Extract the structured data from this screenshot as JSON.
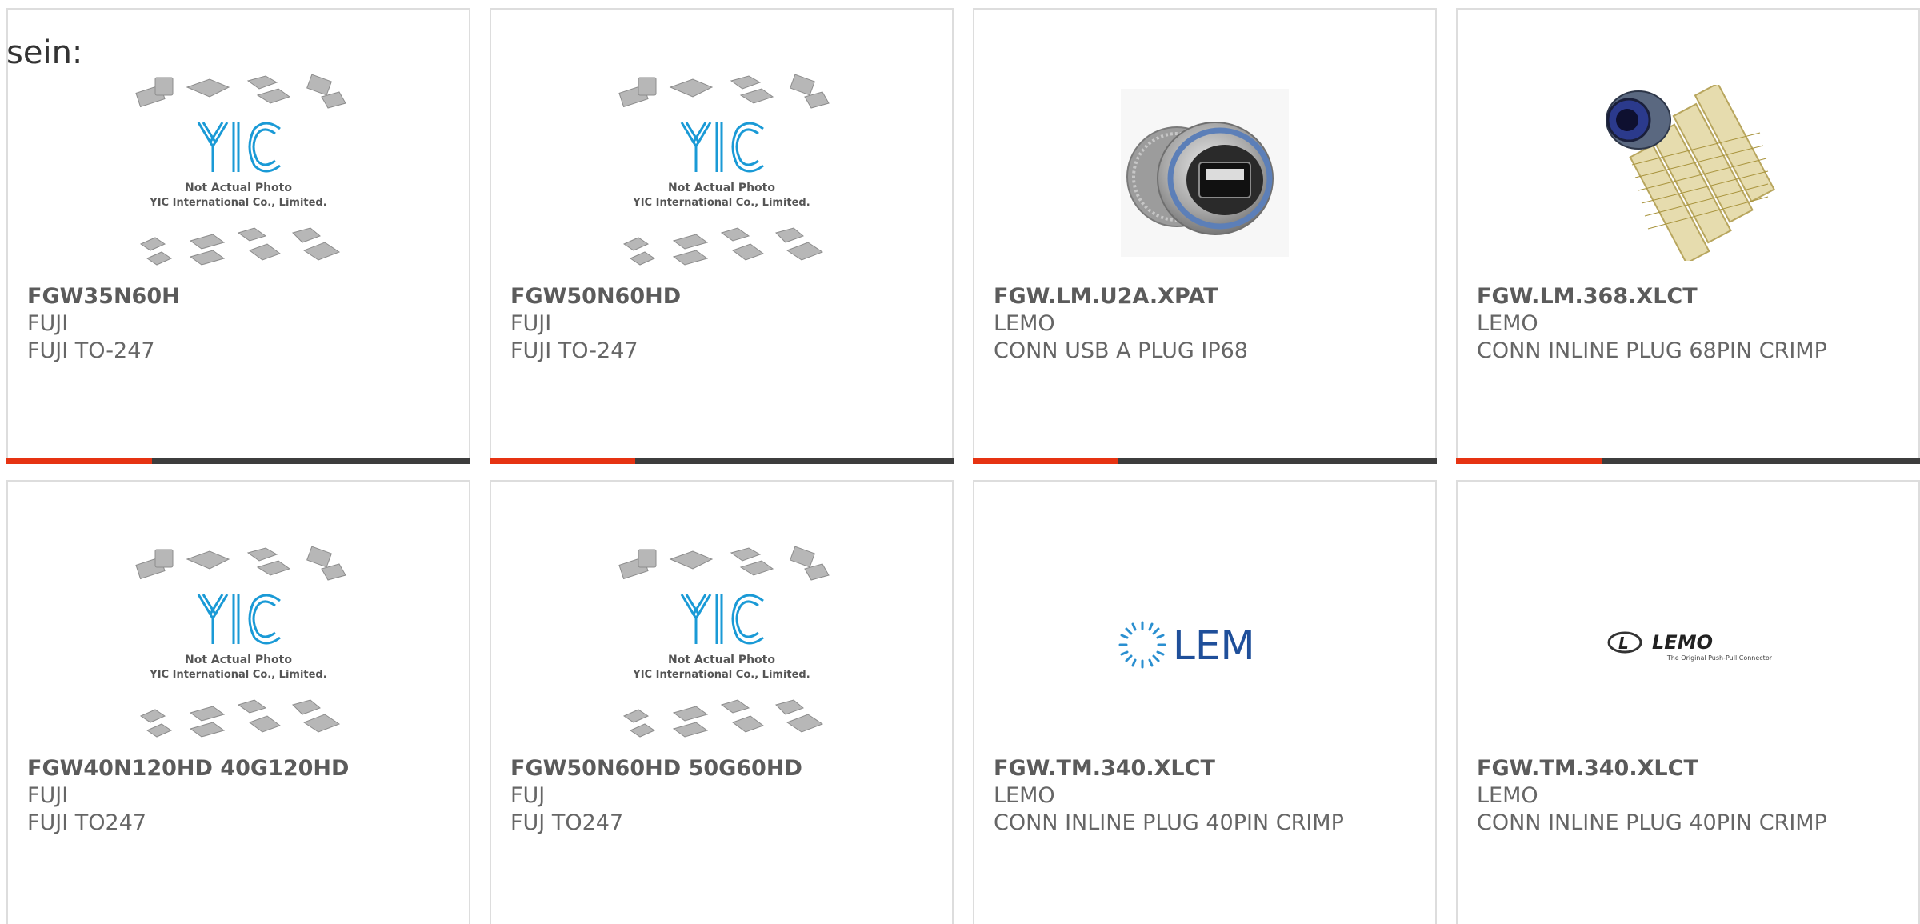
{
  "intro_text": "sein:",
  "colors": {
    "accent": "#e63312",
    "bar": "#3d3d3d",
    "border": "#dddddd",
    "text": "#666666",
    "yic_blue": "#1a9ad6"
  },
  "placeholder_image": {
    "line1": "Not Actual Photo",
    "line2": "YIC International Co., Limited."
  },
  "products": [
    {
      "part_number": "FGW35N60H",
      "manufacturer": "FUJI",
      "description": "FUJI TO-247",
      "image": "yic-placeholder"
    },
    {
      "part_number": "FGW50N60HD",
      "manufacturer": "FUJI",
      "description": "FUJI TO-247",
      "image": "yic-placeholder"
    },
    {
      "part_number": "FGW.LM.U2A.XPAT",
      "manufacturer": "LEMO",
      "description": "CONN USB A PLUG IP68",
      "image": "usb-connector-photo"
    },
    {
      "part_number": "FGW.LM.368.XLCT",
      "manufacturer": "LEMO",
      "description": "CONN INLINE PLUG 68PIN CRIMP",
      "image": "inline-plug-with-pins-photo"
    },
    {
      "part_number": "FGW40N120HD 40G120HD",
      "manufacturer": "FUJI",
      "description": "FUJI TO247",
      "image": "yic-placeholder"
    },
    {
      "part_number": "FGW50N60HD 50G60HD",
      "manufacturer": "FUJ",
      "description": "FUJ TO247",
      "image": "yic-placeholder"
    },
    {
      "part_number": "FGW.TM.340.XLCT",
      "manufacturer": "LEMO",
      "description": "CONN INLINE PLUG 40PIN CRIMP",
      "image": "lem-logo",
      "logo_text": "LEM"
    },
    {
      "part_number": "FGW.TM.340.XLCT",
      "manufacturer": "LEMO",
      "description": "CONN INLINE PLUG 40PIN CRIMP",
      "image": "lemo-logo",
      "logo_text": "LEMO",
      "logo_tagline": "The Original Push-Pull Connector"
    }
  ]
}
